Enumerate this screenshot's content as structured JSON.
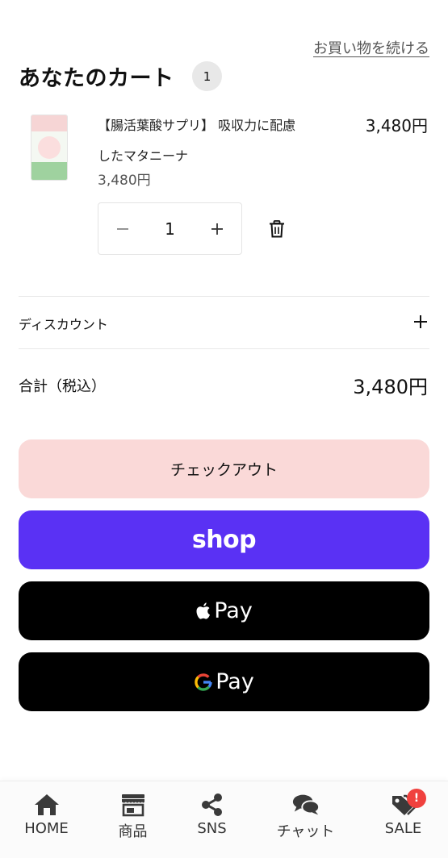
{
  "header": {
    "continue_shopping": "お買い物を続ける",
    "title": "あなたのカート",
    "item_count": "1"
  },
  "cart_item": {
    "name": "【腸活葉酸サプリ】 吸収力に配慮したマタニーナ",
    "line_price": "3,480円",
    "unit_price": "3,480円",
    "quantity": "1",
    "thumbnail_icon": "product-package-image"
  },
  "discount": {
    "label": "ディスカウント"
  },
  "total": {
    "label": "合計（税込）",
    "value": "3,480円"
  },
  "buttons": {
    "checkout": "チェックアウト",
    "shop_pay": "shop",
    "apple_pay": "Pay",
    "google_pay": "Pay"
  },
  "colors": {
    "checkout_bg": "#fad9d8",
    "shop_pay_bg": "#5a31f4",
    "wallet_bg": "#000000",
    "sale_badge": "#f0413e"
  },
  "bottom_nav": {
    "items": [
      {
        "label": "HOME",
        "icon": "home-icon"
      },
      {
        "label": "商品",
        "icon": "store-icon"
      },
      {
        "label": "SNS",
        "icon": "share-icon"
      },
      {
        "label": "チャット",
        "icon": "chat-icon"
      },
      {
        "label": "SALE",
        "icon": "tag-icon",
        "badge": "!"
      }
    ]
  }
}
